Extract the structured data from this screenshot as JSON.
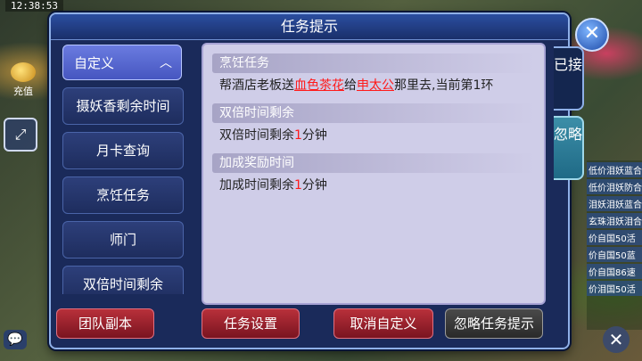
{
  "hud": {
    "time": "12:38:53",
    "recharge_label": "充值"
  },
  "dialog": {
    "title": "任务提示",
    "close_symbol": "✕"
  },
  "nav": {
    "items": [
      {
        "label": "自定义",
        "active": true
      },
      {
        "label": "摄妖香剩余时间"
      },
      {
        "label": "月卡查询"
      },
      {
        "label": "烹饪任务"
      },
      {
        "label": "师门"
      },
      {
        "label": "双倍时间剩余"
      }
    ],
    "chevron": "︿"
  },
  "content": {
    "sections": [
      {
        "title": "烹饪任务",
        "parts": [
          "帮酒店老板送",
          "血色茶花",
          "给",
          "申太公",
          "那里去,当前第1环"
        ]
      },
      {
        "title": "双倍时间剩余",
        "parts": [
          "双倍时间剩余",
          "1",
          "分钟"
        ]
      },
      {
        "title": "加成奖励时间",
        "parts": [
          "加成时间剩余",
          "1",
          "分钟"
        ]
      }
    ]
  },
  "tabs": {
    "done": "已接",
    "ignore": "忽略"
  },
  "buttons": {
    "team_dungeon": "团队副本",
    "task_settings": "任务设置",
    "cancel_custom": "取消自定义",
    "ignore_prompt": "忽略任务提示"
  },
  "right_strip": [
    "低价泪妖蓝合",
    "低价泪妖防合",
    "泪妖泪妖蓝合",
    "玄珠泪妖泪合",
    "价自国50活",
    "价自国50蓝",
    "价自国86速",
    "价泪国50活"
  ],
  "colors": {
    "dialog_bg": "#1a2a5a",
    "content_bg": "#cfcde8",
    "highlight_red": "#ff1a1a",
    "active_nav": "#5565d0"
  }
}
